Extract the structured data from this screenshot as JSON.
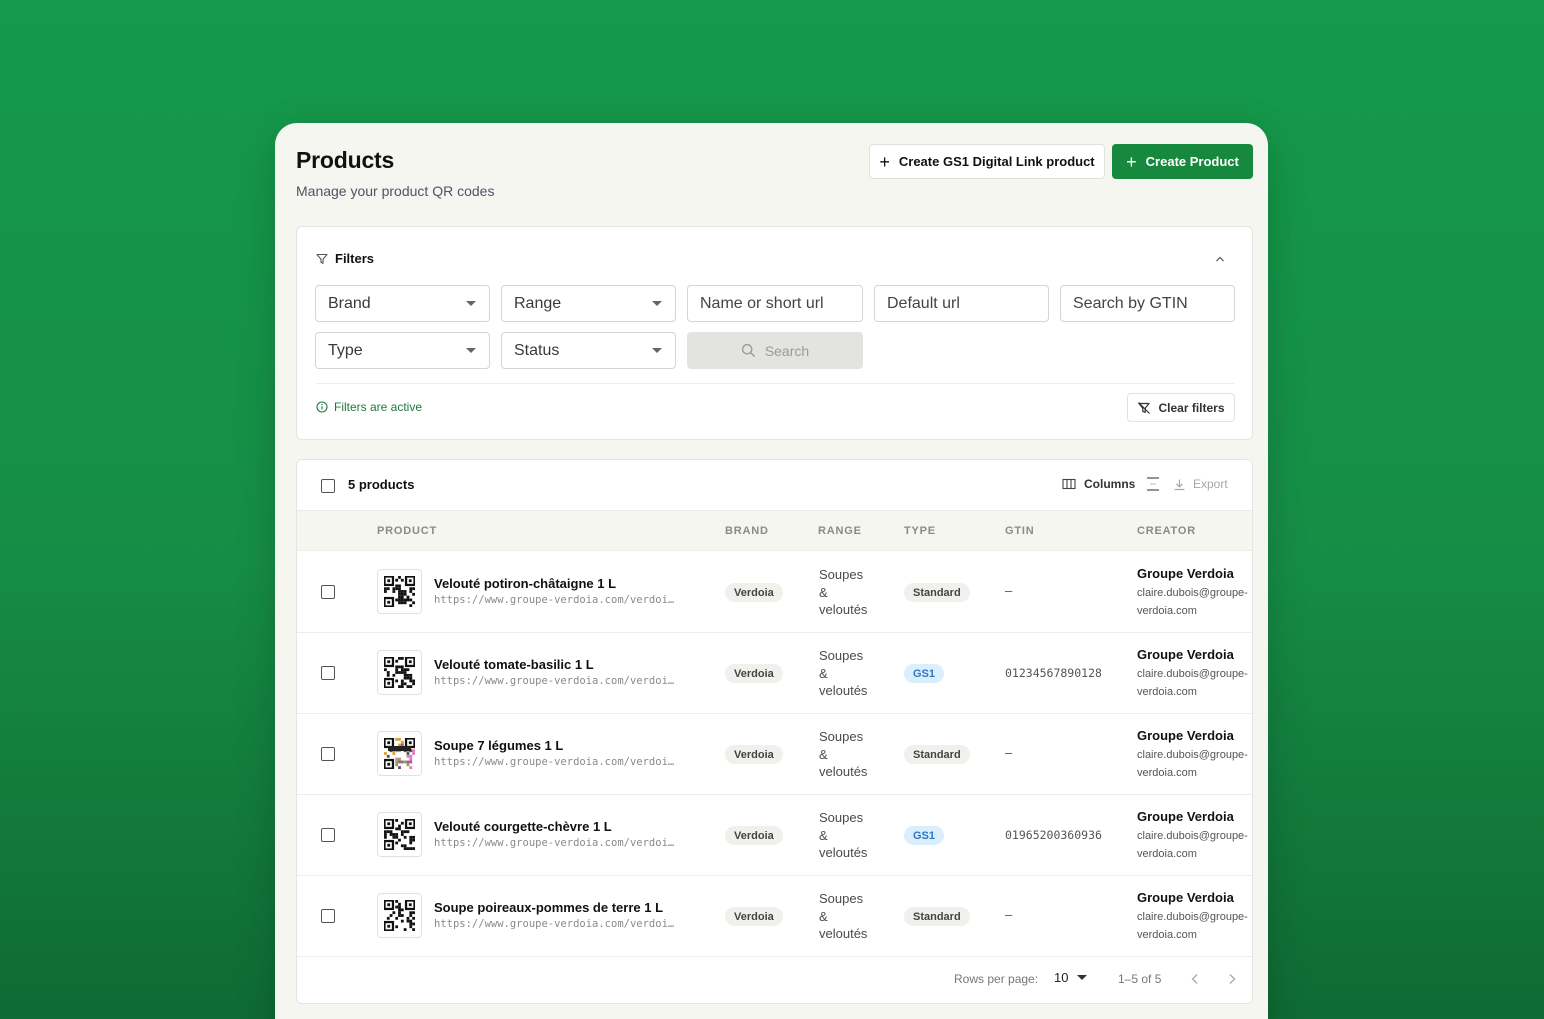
{
  "header": {
    "title": "Products",
    "subtitle": "Manage your product QR codes",
    "gs1_button": "Create GS1 Digital Link product",
    "create_button": "Create Product",
    "accent": "#16893f"
  },
  "filters": {
    "title": "Filters",
    "brand": "Brand",
    "range": "Range",
    "name_placeholder": "Name or short url",
    "default_url_placeholder": "Default url",
    "gtin_placeholder": "Search by GTIN",
    "type": "Type",
    "status": "Status",
    "search_button": "Search",
    "active_note": "Filters are active",
    "clear_button": "Clear filters"
  },
  "table": {
    "count_label": "5 products",
    "columns_button": "Columns",
    "export_button": "Export",
    "headers": [
      "PRODUCT",
      "BRAND",
      "RANGE",
      "TYPE",
      "GTIN",
      "CREATOR"
    ],
    "rows": [
      {
        "name": "Velouté potiron-châtaigne 1 L",
        "url": "https://www.groupe-verdoia.com/verdoi…",
        "brand": "Verdoia",
        "range_lines": [
          "Soupes",
          "&",
          "veloutés"
        ],
        "type": "Standard",
        "gtin": "–",
        "creator_name": "Groupe Verdoia",
        "creator_email": "claire.dubois@groupe-verdoia.com",
        "thumb": "qr-icon"
      },
      {
        "name": "Velouté tomate-basilic 1 L",
        "url": "https://www.groupe-verdoia.com/verdoi…",
        "brand": "Verdoia",
        "range_lines": [
          "Soupes",
          "&",
          "veloutés"
        ],
        "type": "GS1",
        "gtin": "01234567890128",
        "creator_name": "Groupe Verdoia",
        "creator_email": "claire.dubois@groupe-verdoia.com",
        "thumb": "qr-icon"
      },
      {
        "name": "Soupe 7 légumes 1 L",
        "url": "https://www.groupe-verdoia.com/verdoi…",
        "brand": "Verdoia",
        "range_lines": [
          "Soupes",
          "&",
          "veloutés"
        ],
        "type": "Standard",
        "gtin": "–",
        "creator_name": "Groupe Verdoia",
        "creator_email": "claire.dubois@groupe-verdoia.com",
        "thumb": "custom-qr-image-icon"
      },
      {
        "name": "Velouté courgette-chèvre 1 L",
        "url": "https://www.groupe-verdoia.com/verdoi…",
        "brand": "Verdoia",
        "range_lines": [
          "Soupes",
          "&",
          "veloutés"
        ],
        "type": "GS1",
        "gtin": "01965200360936",
        "creator_name": "Groupe Verdoia",
        "creator_email": "claire.dubois@groupe-verdoia.com",
        "thumb": "qr-icon"
      },
      {
        "name": "Soupe poireaux-pommes de terre 1 L",
        "url": "https://www.groupe-verdoia.com/verdoi…",
        "brand": "Verdoia",
        "range_lines": [
          "Soupes",
          "&",
          "veloutés"
        ],
        "type": "Standard",
        "gtin": "–",
        "creator_name": "Groupe Verdoia",
        "creator_email": "claire.dubois@groupe-verdoia.com",
        "thumb": "qr-icon"
      }
    ]
  },
  "pagination": {
    "rows_per_page_label": "Rows per page:",
    "rows_per_page": "10",
    "range_label": "1–5 of 5"
  }
}
